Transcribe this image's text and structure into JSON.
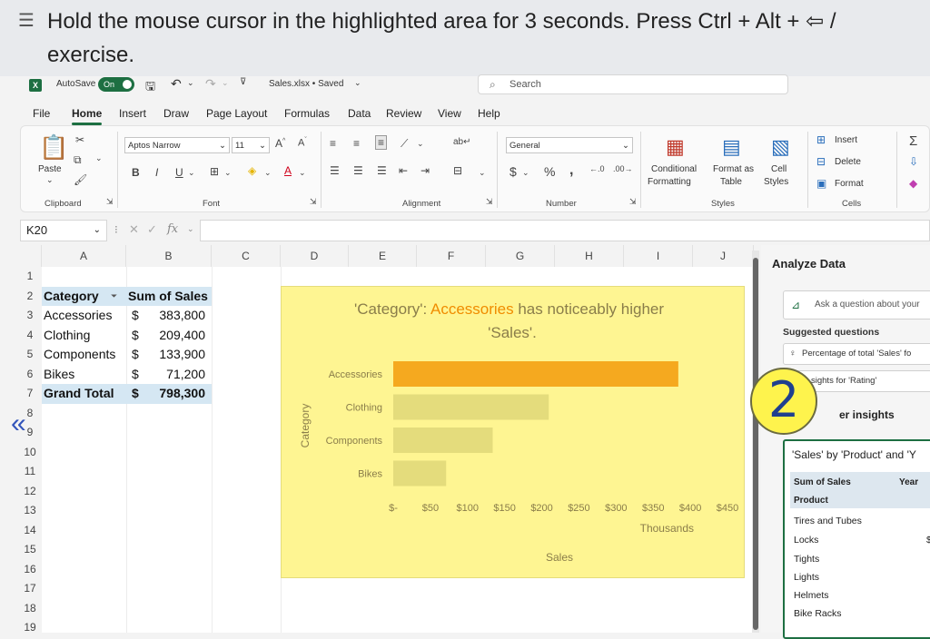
{
  "banner": {
    "line1": "Hold the mouse cursor in the highlighted area for 3 seconds. Press Ctrl + Alt + ⇦ /",
    "line2": "exercise."
  },
  "titlebar": {
    "autosave_label": "AutoSave",
    "toggle_label": "On",
    "filename": "Sales.xlsx • Saved",
    "search_placeholder": "Search"
  },
  "menu": [
    "File",
    "Home",
    "Insert",
    "Draw",
    "Page Layout",
    "Formulas",
    "Data",
    "Review",
    "View",
    "Help"
  ],
  "ribbon": {
    "clipboard": {
      "paste": "Paste",
      "label": "Clipboard"
    },
    "font": {
      "name": "Aptos Narrow",
      "size": "11",
      "label": "Font"
    },
    "alignment": {
      "label": "Alignment"
    },
    "number": {
      "format": "General",
      "label": "Number"
    },
    "styles": {
      "conditional": "Conditional",
      "conditional2": "Formatting",
      "format_as": "Format as",
      "format_as2": "Table",
      "cell": "Cell",
      "cell2": "Styles",
      "label": "Styles"
    },
    "cells": {
      "insert": "Insert",
      "delete": "Delete",
      "format": "Format",
      "label": "Cells"
    }
  },
  "formula_bar": {
    "name_box": "K20",
    "fx": "fx"
  },
  "columns": [
    "A",
    "B",
    "C",
    "D",
    "E",
    "F",
    "G",
    "H",
    "I",
    "J"
  ],
  "rows": [
    "1",
    "2",
    "3",
    "4",
    "5",
    "6",
    "7",
    "8",
    "9",
    "10",
    "11",
    "12",
    "13",
    "14",
    "15",
    "16",
    "17",
    "18",
    "19"
  ],
  "table": {
    "header": [
      "Category",
      "Sum of Sales"
    ],
    "rows": [
      {
        "category": "Accessories",
        "currency": "$",
        "value": "383,800"
      },
      {
        "category": "Clothing",
        "currency": "$",
        "value": "209,400"
      },
      {
        "category": "Components",
        "currency": "$",
        "value": "133,900"
      },
      {
        "category": "Bikes",
        "currency": "$",
        "value": "71,200"
      }
    ],
    "total": {
      "category": "Grand Total",
      "currency": "$",
      "value": "798,300"
    }
  },
  "chart_data": {
    "type": "bar",
    "title_prefix": "'Category': ",
    "title_highlight": "Accessories",
    "title_suffix": " has noticeably higher",
    "title_line2": "'Sales'.",
    "categories": [
      "Accessories",
      "Clothing",
      "Components",
      "Bikes"
    ],
    "values": [
      383.8,
      209.4,
      133.9,
      71.2
    ],
    "xlim": [
      0,
      450
    ],
    "xticks": [
      "$-",
      "$50",
      "$100",
      "$150",
      "$200",
      "$250",
      "$300",
      "$350",
      "$400",
      "$450"
    ],
    "units_label": "Thousands",
    "xlabel": "Sales",
    "ylabel": "Category",
    "highlight_color": "#f5a91f",
    "bar_color": "#e4dc7c"
  },
  "panel": {
    "title": "Analyze Data",
    "ask_placeholder": "Ask a question about your",
    "suggested": "Suggested questions",
    "chip1": "Percentage of total 'Sales' fo",
    "chip2": "sights for 'Rating'",
    "more": "er insights",
    "card_title": "'Sales' by 'Product' and 'Y",
    "card_head1": "Sum of Sales",
    "card_head2": "Year",
    "card_head3": "Product",
    "card_items": [
      "Tires and Tubes",
      "Locks",
      "Tights",
      "Lights",
      "Helmets",
      "Bike Racks"
    ],
    "card_partial": "$"
  },
  "step_badge": "2",
  "nav_icon": "double-chevron-left-icon"
}
